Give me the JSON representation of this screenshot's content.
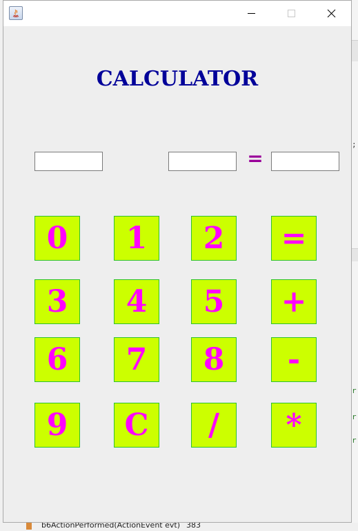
{
  "window": {
    "title": "CALCULATOR",
    "equals_label": "="
  },
  "inputs": {
    "operand1": "",
    "operand2": "",
    "result": ""
  },
  "keys": {
    "k0": "0",
    "k1": "1",
    "k2": "2",
    "k_eq": "=",
    "k3": "3",
    "k4": "4",
    "k5": "5",
    "k_plus": "+",
    "k6": "6",
    "k7": "7",
    "k8": "8",
    "k_minus": "-",
    "k9": "9",
    "k_clear": "C",
    "k_div": "/",
    "k_mul": "*"
  },
  "background": {
    "bottom_method": "b6ActionPerformed(ActionEvent evt)",
    "bottom_line": "383"
  },
  "colors": {
    "title": "#000099",
    "key_fill": "#ccff00",
    "key_text": "#ff00ff",
    "key_border": "#2cc22c",
    "equals_label": "#990099"
  },
  "icons": [
    "java-app-icon",
    "minimize-icon",
    "maximize-icon",
    "close-icon"
  ]
}
